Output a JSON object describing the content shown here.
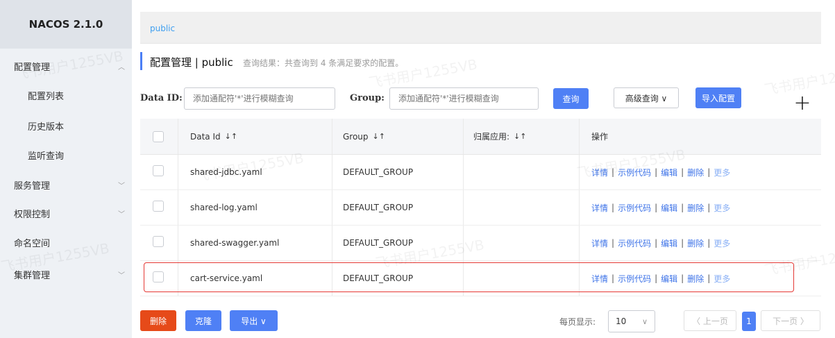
{
  "brand": "NACOS 2.1.0",
  "sidebar": {
    "items": [
      {
        "label": "配置管理",
        "chevron": "︿"
      },
      {
        "label": "配置列表"
      },
      {
        "label": "历史版本"
      },
      {
        "label": "监听查询"
      },
      {
        "label": "服务管理",
        "chevron": "﹀"
      },
      {
        "label": "权限控制",
        "chevron": "﹀"
      },
      {
        "label": "命名空间"
      },
      {
        "label": "集群管理",
        "chevron": "﹀"
      }
    ]
  },
  "namespace": "public",
  "header": {
    "title": "配置管理 | public",
    "summary": "查询结果：共查询到 4 条满足要求的配置。"
  },
  "filters": {
    "dataid_label": "Data ID:",
    "dataid_placeholder": "添加通配符'*'进行模糊查询",
    "group_label": "Group:",
    "group_placeholder": "添加通配符'*'进行模糊查询",
    "query_btn": "查询",
    "advanced_btn": "高级查询 ∨",
    "import_btn": "导入配置",
    "add_btn": "+"
  },
  "table": {
    "columns": [
      "Data Id",
      "Group",
      "归属应用:",
      "操作"
    ],
    "sort_icon": "↓↑",
    "rows": [
      {
        "dataid": "shared-jdbc.yaml",
        "group": "DEFAULT_GROUP",
        "app": ""
      },
      {
        "dataid": "shared-log.yaml",
        "group": "DEFAULT_GROUP",
        "app": ""
      },
      {
        "dataid": "shared-swagger.yaml",
        "group": "DEFAULT_GROUP",
        "app": ""
      },
      {
        "dataid": "cart-service.yaml",
        "group": "DEFAULT_GROUP",
        "app": ""
      }
    ],
    "ops": {
      "detail": "详情",
      "sample": "示例代码",
      "edit": "编辑",
      "delete": "删除",
      "more": "更多"
    }
  },
  "footer": {
    "delete_btn": "删除",
    "clone_btn": "克隆",
    "export_btn": "导出 ∨",
    "page_size_label": "每页显示:",
    "page_size": "10",
    "prev": "〈 上一页",
    "page": "1",
    "next": "下一页 〉"
  },
  "watermark": "飞书用户1255VB",
  "colors": {
    "primary": "#4f80f5",
    "danger": "#e64a19",
    "highlight": "#e53935",
    "link": "#3f74e8"
  }
}
